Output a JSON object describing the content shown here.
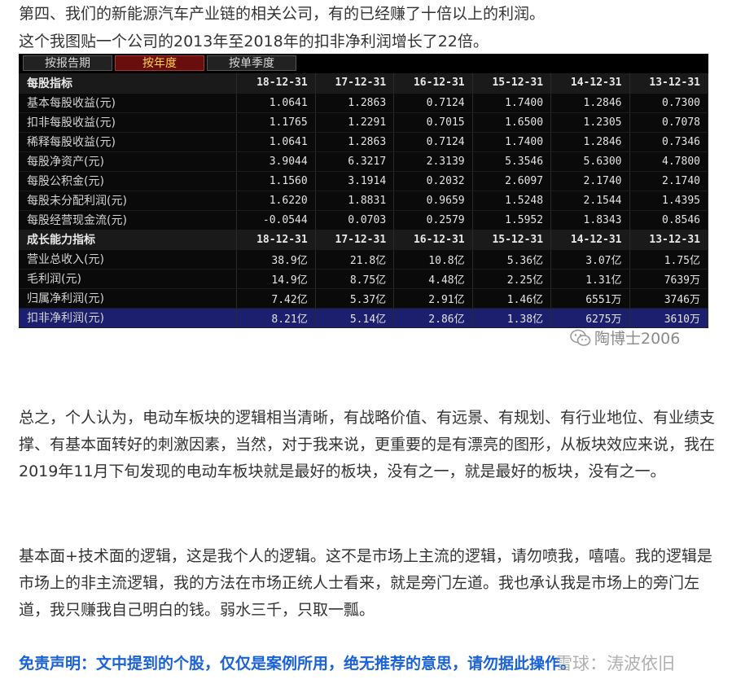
{
  "intro": {
    "line1": "第四、我们的新能源汽车产业链的相关公司，有的已经赚了十倍以上的利润。",
    "line2": "这个我图贴一个公司的2013年至2018年的扣非净利润增长了22倍。"
  },
  "tabs": [
    "按报告期",
    "按年度",
    "按单季度"
  ],
  "active_tab": "按年度",
  "sections": [
    {
      "title": "每股指标",
      "periods": [
        "18-12-31",
        "17-12-31",
        "16-12-31",
        "15-12-31",
        "14-12-31",
        "13-12-31"
      ],
      "rows": [
        {
          "label": "基本每股收益(元)",
          "values": [
            "1.0641",
            "1.2863",
            "0.7124",
            "1.7400",
            "1.2846",
            "0.7300"
          ]
        },
        {
          "label": "扣非每股收益(元)",
          "values": [
            "1.1765",
            "1.2291",
            "0.7015",
            "1.6500",
            "1.2305",
            "0.7078"
          ]
        },
        {
          "label": "稀释每股收益(元)",
          "values": [
            "1.0641",
            "1.2863",
            "0.7124",
            "1.7400",
            "1.2846",
            "0.7346"
          ]
        },
        {
          "label": "每股净资产(元)",
          "values": [
            "3.9044",
            "6.3217",
            "2.3139",
            "5.3546",
            "5.6300",
            "4.7800"
          ]
        },
        {
          "label": "每股公积金(元)",
          "values": [
            "1.1560",
            "3.1914",
            "0.2032",
            "2.6097",
            "2.1740",
            "2.1740"
          ]
        },
        {
          "label": "每股未分配利润(元)",
          "values": [
            "1.6220",
            "1.8831",
            "0.9659",
            "1.5248",
            "2.1544",
            "1.4395"
          ]
        },
        {
          "label": "每股经营现金流(元)",
          "values": [
            "-0.0544",
            "0.0703",
            "0.2579",
            "1.5952",
            "1.8343",
            "0.8546"
          ]
        }
      ]
    },
    {
      "title": "成长能力指标",
      "periods": [
        "18-12-31",
        "17-12-31",
        "16-12-31",
        "15-12-31",
        "14-12-31",
        "13-12-31"
      ],
      "rows": [
        {
          "label": "营业总收入(元)",
          "values": [
            "38.9亿",
            "21.8亿",
            "10.8亿",
            "5.36亿",
            "3.07亿",
            "1.75亿"
          ]
        },
        {
          "label": "毛利润(元)",
          "values": [
            "14.9亿",
            "8.75亿",
            "4.48亿",
            "2.25亿",
            "1.31亿",
            "7639万"
          ]
        },
        {
          "label": "归属净利润(元)",
          "values": [
            "7.42亿",
            "5.37亿",
            "2.91亿",
            "1.46亿",
            "6551万",
            "3746万"
          ]
        },
        {
          "label": "扣非净利润(元)",
          "values": [
            "8.21亿",
            "5.14亿",
            "2.86亿",
            "1.38亿",
            "6275万",
            "3610万"
          ]
        }
      ]
    }
  ],
  "watermark_top": "陶博士2006",
  "paragraphs": [
    "总之，个人认为，电动车板块的逻辑相当清晰，有战略价值、有远景、有规划、有行业地位、有业绩支撑、有基本面转好的刺激因素，当然，对于我来说，更重要的是有漂亮的图形，从板块效应来说，我在2019年11月下旬发现的电动车板块就是最好的板块，没有之一，就是最好的板块，没有之一。",
    "基本面+技术面的逻辑，这是我个人的逻辑。这不是市场上主流的逻辑，请勿喷我，嘻嘻。我的逻辑是市场上的非主流逻辑，我的方法在市场正统人士看来，就是旁门左道。我也承认我是市场上的旁门左道，我只赚我自己明白的钱。弱水三千，只取一瓢。"
  ],
  "disclaimer": "免责声明：文中提到的个股，仅仅是案例所用，绝无推荐的意思，请勿据此操作。",
  "watermark_bottom": "雪球：涛波依旧",
  "colors": {
    "disclaimer": "#1a62d6",
    "active_tab": "#6a0d0d",
    "selected_row": "#1b1f6e"
  }
}
